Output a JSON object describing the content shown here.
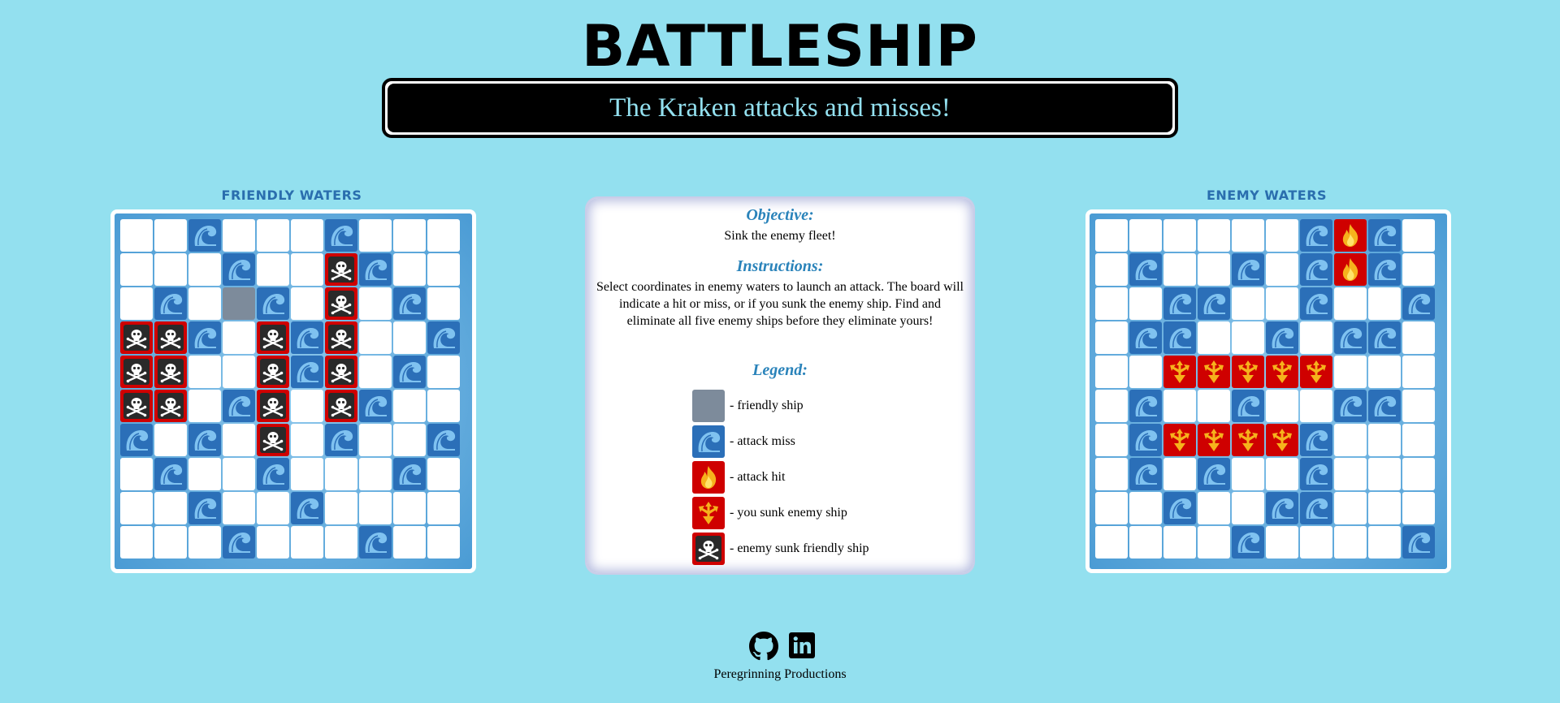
{
  "title": "BATTLESHIP",
  "status_message": "The Kraken attacks and misses!",
  "friendly_board": {
    "title": "FRIENDLY WATERS",
    "rows": [
      "..M...M...",
      "...M..LM..",
      ".M.SM.L.M.",
      "LLM.LML..M",
      "LL..LML.M.",
      "LL.ML.LM..",
      "M.M.L.M..M",
      ".M..M...M.",
      "..M..M....",
      "...M...M.."
    ]
  },
  "enemy_board": {
    "title": "ENEMY WATERS",
    "rows": [
      "......MHM.",
      ".M..M.MHM.",
      "..MM..M..M",
      ".MM..M.MM.",
      "..KKKKK...",
      ".M..M..MM.",
      ".MKKKKM...",
      ".M.M..M...",
      "..M..MM...",
      "....M....M"
    ]
  },
  "info": {
    "objective_heading": "Objective:",
    "objective_text": "Sink the enemy fleet!",
    "instructions_heading": "Instructions:",
    "instructions_text": "Select coordinates in enemy waters to launch an attack. The board will indicate a hit or miss, or if you sunk the enemy ship. Find and eliminate all five enemy ships before they eliminate yours!",
    "legend_heading": "Legend:",
    "legend": [
      {
        "type": "ship",
        "icon": "friendly-ship-swatch",
        "label": "- friendly ship"
      },
      {
        "type": "miss",
        "icon": "wave-icon",
        "label": "- attack miss"
      },
      {
        "type": "hit",
        "icon": "fire-icon",
        "label": "- attack hit"
      },
      {
        "type": "sunk",
        "icon": "trident-icon",
        "label": "- you sunk enemy ship"
      },
      {
        "type": "lost",
        "icon": "skull-crossbones-icon",
        "label": "- enemy sunk friendly ship"
      }
    ]
  },
  "footer": {
    "icons": [
      "github-icon",
      "linkedin-icon"
    ],
    "credit": "Peregrinning Productions"
  },
  "colors": {
    "background": "#93e0ef",
    "miss": "#2b6fb8",
    "hit": "#cf0000",
    "friendly_ship": "#7d8b9b",
    "heading_blue": "#2a83ba",
    "board_title": "#2a6eae"
  }
}
